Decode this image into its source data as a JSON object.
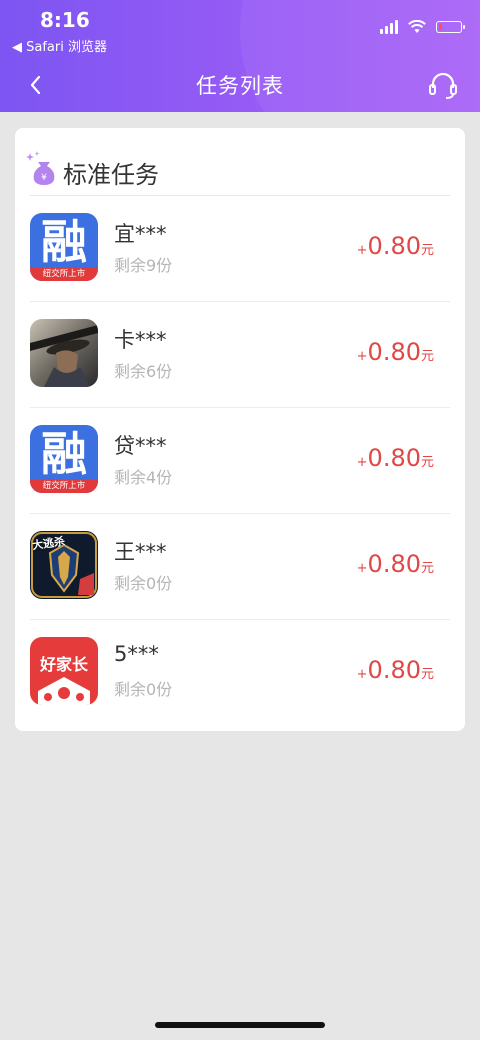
{
  "status_bar": {
    "time": "8:16",
    "back_app": "◀ Safari 浏览器",
    "icons": [
      "signal-icon",
      "wifi-icon",
      "battery-icon"
    ]
  },
  "nav": {
    "title": "任务列表",
    "back_icon": "chevron-left-icon",
    "service_icon": "headset-icon"
  },
  "section": {
    "title": "标准任务",
    "icon": "money-bag-sparkle-icon"
  },
  "tasks": [
    {
      "name": "宜***",
      "remaining": "剩余9份",
      "reward_sign": "+",
      "reward_amount": "0.80",
      "reward_unit": "元",
      "icon": "rong-app-icon",
      "icon_text": "融",
      "icon_caption": "纽交所上市"
    },
    {
      "name": "卡***",
      "remaining": "剩余6份",
      "reward_sign": "+",
      "reward_amount": "0.80",
      "reward_unit": "元",
      "icon": "warrior-game-icon"
    },
    {
      "name": "贷***",
      "remaining": "剩余4份",
      "reward_sign": "+",
      "reward_amount": "0.80",
      "reward_unit": "元",
      "icon": "rong-app-icon",
      "icon_text": "融",
      "icon_caption": "纽交所上市"
    },
    {
      "name": "王***",
      "remaining": "剩余0份",
      "reward_sign": "+",
      "reward_amount": "0.80",
      "reward_unit": "元",
      "icon": "battle-royale-game-icon",
      "icon_text": "大逃杀"
    },
    {
      "name": "5***",
      "remaining": "剩余0份",
      "reward_sign": "+",
      "reward_amount": "0.80",
      "reward_unit": "元",
      "icon": "good-parent-app-icon",
      "icon_text": "好家长"
    }
  ],
  "colors": {
    "header_start": "#7d55f2",
    "header_end": "#a862f7",
    "reward": "#e04848",
    "background": "#e6e6e6"
  }
}
